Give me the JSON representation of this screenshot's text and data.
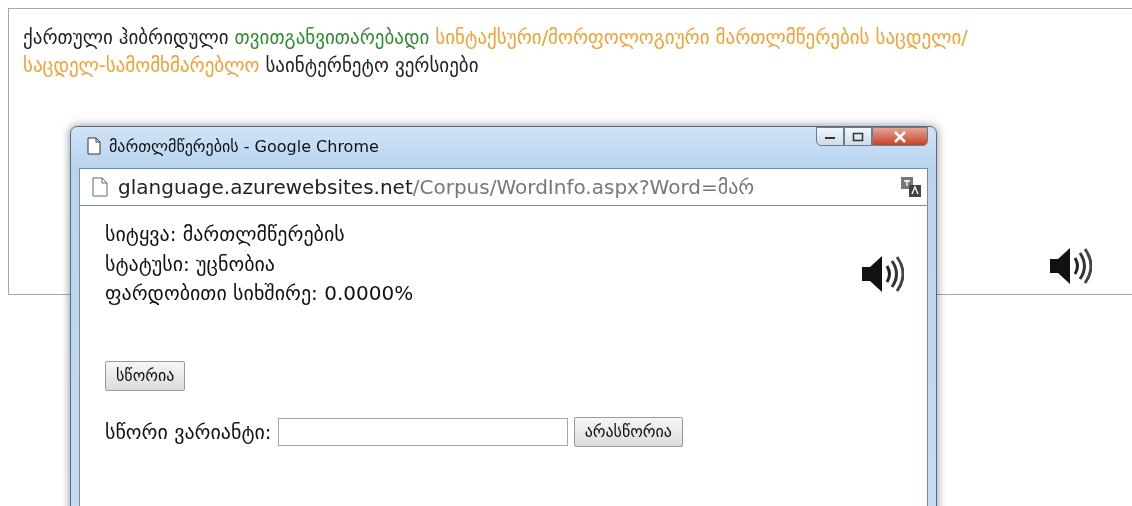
{
  "page": {
    "paragraph": [
      {
        "text": "ქართული ჰიბრიდული ",
        "color": "#222222"
      },
      {
        "text": "თვითგანვითარებადი",
        "color": "#2e8b2e"
      },
      {
        "text": " სინტაქსური/მორფოლოგიური მართლმწერების საცდელი/საცდელ-სამომხმარებლო",
        "color": "#f5a033"
      },
      {
        "text": " საინტერნეტო ვერსიები",
        "color": "#222222"
      }
    ]
  },
  "popup": {
    "title": "მართლმწერების - Google Chrome",
    "url_host": "glanguage.azurewebsites.net",
    "url_path": "/Corpus/WordInfo.aspx?Word=მარ",
    "lines": [
      "სიტყვა: მართლმწერების",
      "სტატუსი: უცნობია",
      "ფარდობითი სიხშირე: 0.0000%"
    ],
    "correct_button": "სწორია",
    "variant_label": "სწორი ვარიანტი:",
    "incorrect_button": "არასწორია"
  }
}
